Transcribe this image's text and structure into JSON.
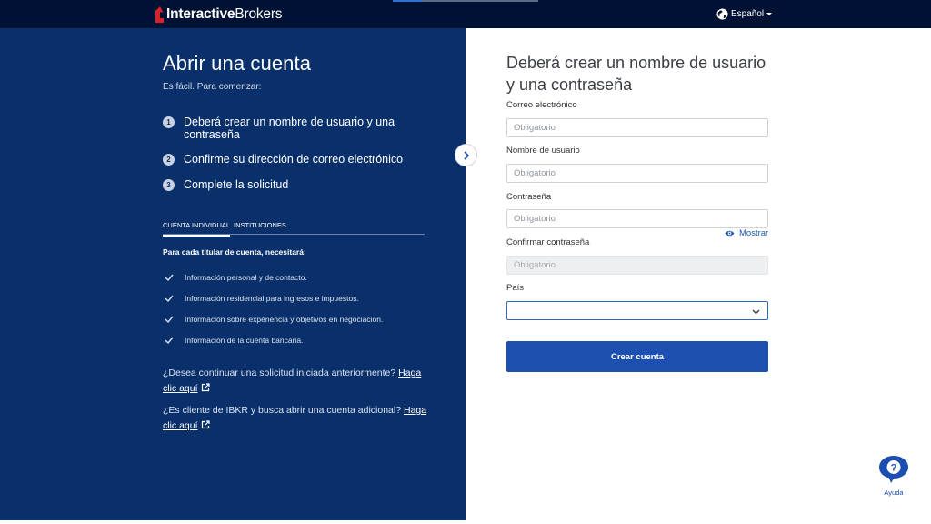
{
  "header": {
    "logo_text_bold": "Interactive",
    "logo_text_regular": "Brokers",
    "language_label": "Español",
    "progress_fraction": 0.2,
    "colors": {
      "background": "#001233",
      "logo_accent": "#d8232a"
    }
  },
  "left_panel": {
    "title": "Abrir una cuenta",
    "subtitle": "Es fácil. Para comenzar:",
    "steps": [
      {
        "number": "1",
        "text": "Deberá crear un nombre de usuario y una contraseña"
      },
      {
        "number": "2",
        "text": "Confirme su dirección de correo electrónico"
      },
      {
        "number": "3",
        "text": "Complete la solicitud"
      }
    ],
    "tabs": [
      {
        "label": "CUENTA INDIVIDUAL",
        "active": true
      },
      {
        "label": "INSTITUCIONES",
        "active": false
      }
    ],
    "requirements_heading": "Para cada titular de cuenta, necesitará:",
    "requirements": [
      "Información personal y de contacto.",
      "Información residencial para ingresos e impuestos.",
      "Información sobre experiencia y objetivos en negociación.",
      "Información de la cuenta bancaria."
    ],
    "continue_question": "¿Desea continuar una solicitud iniciada anteriormente?",
    "continue_link": "Haga clic aquí",
    "client_question": "¿Es cliente de IBKR y busca abrir una cuenta adicional?",
    "client_link": "Haga clic aquí",
    "colors": {
      "background": "#09306b"
    }
  },
  "form": {
    "title": "Deberá crear un nombre de usuario y una contraseña",
    "email_label": "Correo electrónico",
    "email_placeholder": "Obligatorio",
    "username_label": "Nombre de usuario",
    "username_placeholder": "Obligatorio",
    "password_label": "Contraseña",
    "password_placeholder": "Obligatorio",
    "show_label": "Mostrar",
    "confirm_label": "Confirmar contraseña",
    "confirm_placeholder": "Obligatorio",
    "country_label": "País",
    "country_value": "",
    "submit_label": "Crear cuenta",
    "colors": {
      "primary": "#1d4fb0"
    }
  },
  "help": {
    "label": "Ayuda",
    "icon": "question-bubble-icon"
  }
}
